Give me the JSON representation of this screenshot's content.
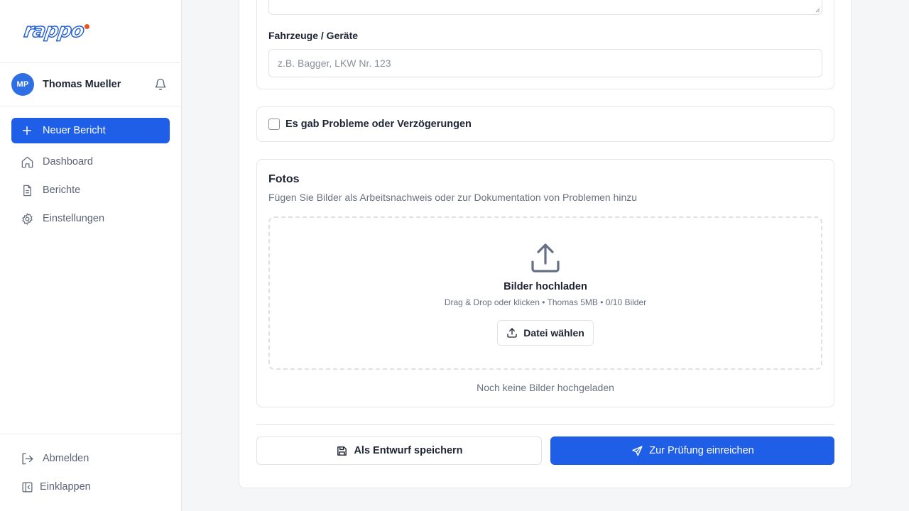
{
  "brand": {
    "logo_text": "rappo",
    "accent": "#1f5fe8",
    "logo_dot": "#f0521e"
  },
  "user": {
    "initials": "MP",
    "name": "Thomas Mueller"
  },
  "sidebar": {
    "new_report_label": "Neuer Bericht",
    "items": [
      {
        "label": "Dashboard",
        "icon": "home-icon"
      },
      {
        "label": "Berichte",
        "icon": "document-icon"
      },
      {
        "label": "Einstellungen",
        "icon": "gear-icon"
      }
    ],
    "logout_label": "Abmelden",
    "collapse_label": "Einklappen"
  },
  "form": {
    "vehicles": {
      "label": "Fahrzeuge / Geräte",
      "placeholder": "z.B. Bagger, LKW Nr. 123",
      "value": ""
    },
    "problems": {
      "label": "Es gab Probleme oder Verzögerungen",
      "checked": false
    },
    "photos": {
      "title": "Fotos",
      "subtitle": "Fügen Sie Bilder als Arbeitsnachweis oder zur Dokumentation von Problemen hinzu",
      "upload_title": "Bilder hochladen",
      "upload_hint": "Drag & Drop oder klicken • Thomas 5MB • 0/10 Bilder",
      "choose_label": "Datei wählen",
      "empty_note": "Noch keine Bilder hochgeladen"
    },
    "actions": {
      "draft_label": "Als Entwurf speichern",
      "submit_label": "Zur Prüfung einreichen"
    }
  }
}
